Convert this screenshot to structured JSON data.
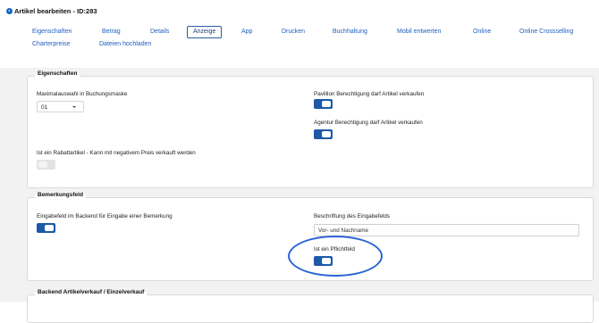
{
  "page": {
    "title": "Artikel bearbeiten - ID:283"
  },
  "tabs": [
    {
      "label": "Eigenschaften"
    },
    {
      "label": "Betrag"
    },
    {
      "label": "Details"
    },
    {
      "label": "Anzeige",
      "active": true
    },
    {
      "label": "App"
    },
    {
      "label": "Drucken"
    },
    {
      "label": "Buchhaltung"
    },
    {
      "label": "Mobil entwerten"
    },
    {
      "label": "Online"
    },
    {
      "label": "Online Crossselling"
    },
    {
      "label": "Charterpreise"
    },
    {
      "label": "Dateien hochladen"
    }
  ],
  "sections": {
    "eigenschaften": {
      "title": "Eigenschaften",
      "max_select_label": "Maximalauswahl in Buchungsmaske",
      "max_select_value": "01",
      "pavillion_label": "Pavillion Berechtigung darf Artikel verkaufen",
      "pavillion_on": true,
      "agentur_label": "Agentur Berechtigung darf Artikel verkaufen",
      "agentur_on": true,
      "rabatt_label": "Ist ein Rabattartikel - Kann mit negativem Preis verkauft werden",
      "rabatt_on": false
    },
    "bemerkungsfeld": {
      "title": "Bemerkungsfeld",
      "eingabe_label": "Eingabefeld im Backend für Eingabe einer Bemerkung",
      "eingabe_on": true,
      "beschriftung_label": "Beschriftung des Eingabefelds",
      "beschriftung_value": "Vor- und Nachname",
      "pflicht_label": "Ist ein Pflichtfeld",
      "pflicht_on": true
    },
    "backend": {
      "title": "Backend Artikelverkauf / Einzelverkauf"
    }
  },
  "colors": {
    "accent": "#1c5aa8",
    "link": "#1f5fbf",
    "annotation": "#2a63d4"
  }
}
